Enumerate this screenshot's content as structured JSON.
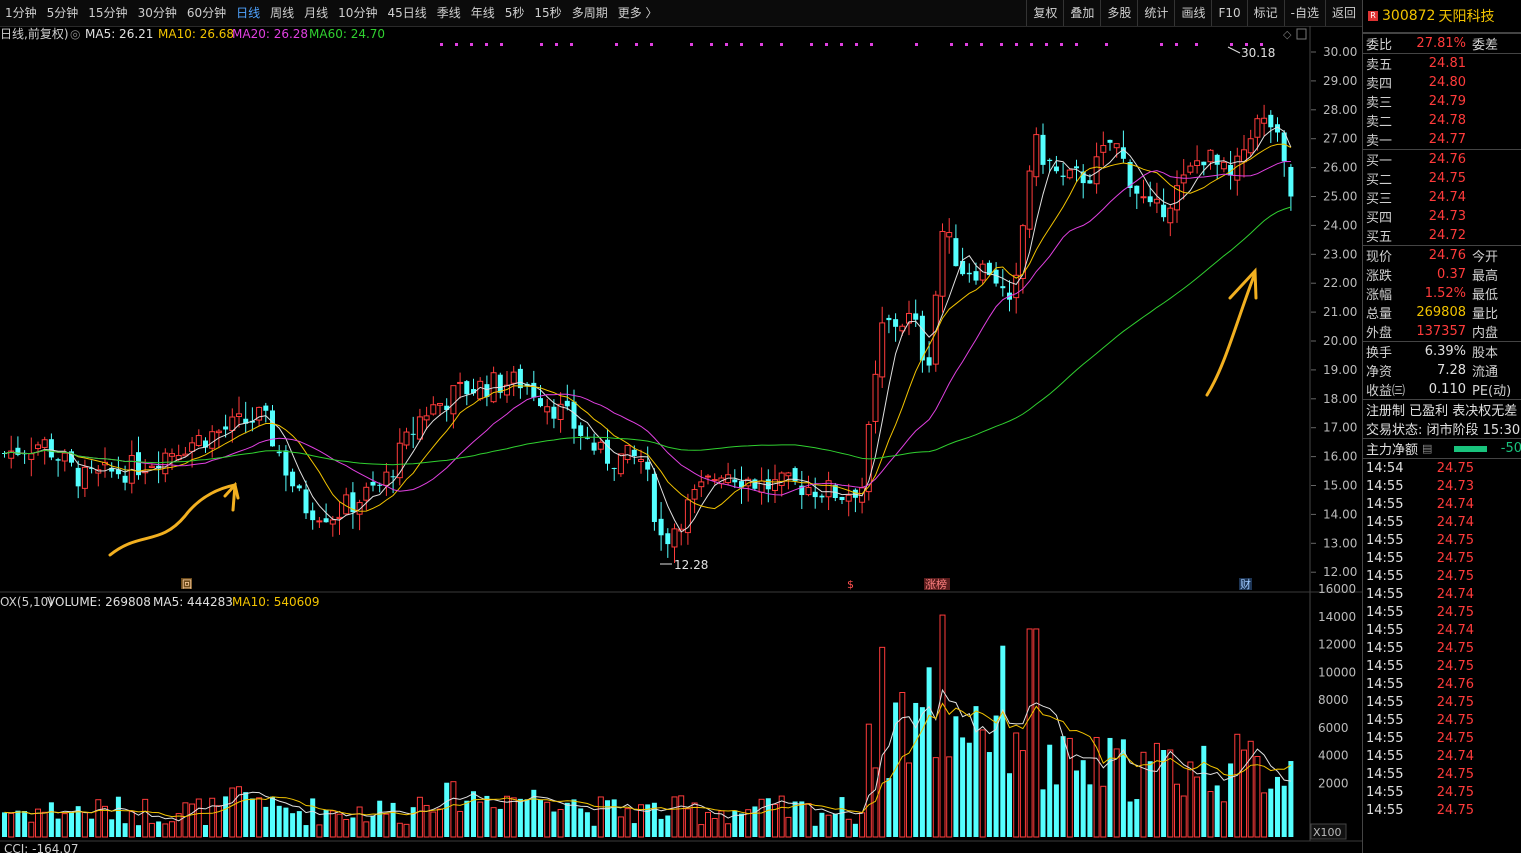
{
  "toolbar": {
    "periods": [
      "1分钟",
      "5分钟",
      "15分钟",
      "30分钟",
      "60分钟",
      "日线",
      "周线",
      "月线",
      "10分钟",
      "45日线",
      "季线",
      "年线",
      "5秒",
      "15秒",
      "多周期",
      "更多 〉"
    ],
    "active_period": "日线",
    "tools": [
      "复权",
      "叠加",
      "多股",
      "统计",
      "画线",
      "F10",
      "标记",
      "-自选",
      "返回"
    ]
  },
  "main_legend": {
    "prefix": "日线,前复权)",
    "ma5": "MA5: 26.21",
    "ma10": "MA10: 26.68",
    "ma20": "MA20: 26.28",
    "ma60": "MA60: 24.70"
  },
  "colors": {
    "ma5": "#e0e0e0",
    "ma10": "#f2c300",
    "ma20": "#e040e0",
    "ma60": "#30d030",
    "up": "#ff3b3b",
    "down": "#54ffff"
  },
  "price_axis": [
    "30.00",
    "29.00",
    "28.00",
    "27.00",
    "26.00",
    "25.00",
    "24.00",
    "23.00",
    "22.00",
    "21.00",
    "20.00",
    "19.00",
    "18.00",
    "17.00",
    "16.00",
    "15.00",
    "14.00",
    "13.00",
    "12.00"
  ],
  "annotations": {
    "high": "30.18",
    "low": "12.28",
    "event_a": "回",
    "event_b": "$",
    "event_c": "涨榜",
    "event_d": "财"
  },
  "volume_legend": {
    "prefix": "OX(5,10)",
    "volume": "VOLUME: 269808",
    "ma5": "MA5: 444283",
    "ma10": "MA10: 540609"
  },
  "volume_axis": [
    "16000",
    "14000",
    "12000",
    "10000",
    "8000",
    "6000",
    "4000",
    "2000"
  ],
  "volume_unit": "X100",
  "indicator": "CCI: -164.07",
  "stock": {
    "code": "300872",
    "name": "天阳科技",
    "badge": "R"
  },
  "quote": {
    "webi_label": "委比",
    "webi": "27.81%",
    "wecha_label": "委差",
    "asks": [
      {
        "l": "卖五",
        "p": "24.81"
      },
      {
        "l": "卖四",
        "p": "24.80"
      },
      {
        "l": "卖三",
        "p": "24.79"
      },
      {
        "l": "卖二",
        "p": "24.78"
      },
      {
        "l": "卖一",
        "p": "24.77"
      }
    ],
    "bids": [
      {
        "l": "买一",
        "p": "24.76"
      },
      {
        "l": "买二",
        "p": "24.75"
      },
      {
        "l": "买三",
        "p": "24.74"
      },
      {
        "l": "买四",
        "p": "24.73"
      },
      {
        "l": "买五",
        "p": "24.72"
      }
    ],
    "stats": [
      {
        "l": "现价",
        "v": "24.76",
        "c": "r",
        "l2": "今开"
      },
      {
        "l": "涨跌",
        "v": "0.37",
        "c": "r",
        "l2": "最高"
      },
      {
        "l": "涨幅",
        "v": "1.52%",
        "c": "r",
        "l2": "最低"
      },
      {
        "l": "总量",
        "v": "269808",
        "c": "y",
        "l2": "量比"
      },
      {
        "l": "外盘",
        "v": "137357",
        "c": "r",
        "l2": "内盘"
      }
    ],
    "stats2": [
      {
        "l": "换手",
        "v": "6.39%",
        "c": "w",
        "l2": "股本"
      },
      {
        "l": "净资",
        "v": "7.28",
        "c": "w",
        "l2": "流通"
      },
      {
        "l": "收益㈢",
        "v": "0.110",
        "c": "w",
        "l2": "PE(动)"
      }
    ],
    "reg": "注册制 已盈利 表决权无差",
    "trade_status": "交易状态: 闭市阶段 15:30",
    "main_net_label": "主力净额",
    "main_net_val": "-50"
  },
  "ticks": [
    {
      "t": "14:54",
      "p": "24.75"
    },
    {
      "t": "14:55",
      "p": "24.73"
    },
    {
      "t": "14:55",
      "p": "24.74"
    },
    {
      "t": "14:55",
      "p": "24.74"
    },
    {
      "t": "14:55",
      "p": "24.75"
    },
    {
      "t": "14:55",
      "p": "24.75"
    },
    {
      "t": "14:55",
      "p": "24.75"
    },
    {
      "t": "14:55",
      "p": "24.74"
    },
    {
      "t": "14:55",
      "p": "24.75"
    },
    {
      "t": "14:55",
      "p": "24.74"
    },
    {
      "t": "14:55",
      "p": "24.75"
    },
    {
      "t": "14:55",
      "p": "24.75"
    },
    {
      "t": "14:55",
      "p": "24.76"
    },
    {
      "t": "14:55",
      "p": "24.75"
    },
    {
      "t": "14:55",
      "p": "24.75"
    },
    {
      "t": "14:55",
      "p": "24.75"
    },
    {
      "t": "14:55",
      "p": "24.74"
    },
    {
      "t": "14:55",
      "p": "24.75"
    },
    {
      "t": "14:55",
      "p": "24.75"
    },
    {
      "t": "14:55",
      "p": "24.75"
    }
  ]
}
